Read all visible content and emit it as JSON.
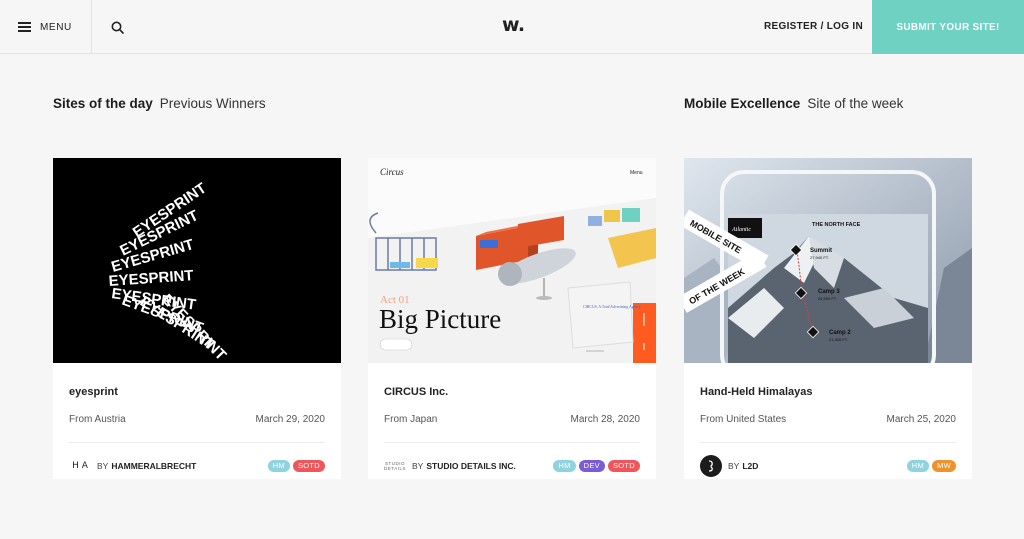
{
  "header": {
    "menu_label": "MENU",
    "logo": "w.",
    "auth_label": "REGISTER / LOG IN",
    "submit_label": "SUBMIT YOUR SITE!"
  },
  "sections": {
    "left": {
      "title": "Sites of the day",
      "subtitle": "Previous Winners"
    },
    "right": {
      "title": "Mobile Excellence",
      "subtitle": "Site of the week"
    }
  },
  "colors": {
    "accent": "#6ed1c1",
    "tag_hm": "#8fd3de",
    "tag_soto": "#f0555a",
    "tag_dev": "#7b5cd6",
    "tag_mw": "#f0922b"
  },
  "cards": [
    {
      "title": "eyesprint",
      "from": "From Austria",
      "date": "March 29, 2020",
      "by": "BY",
      "author": "HAMMERALBRECHT",
      "author_logo_text": "H A",
      "tags": [
        {
          "label": "HM",
          "color": "#8fd3de"
        },
        {
          "label": "SOTD",
          "color": "#f0555a"
        }
      ],
      "thumb_word": "EYESPRINT"
    },
    {
      "title": "CIRCUS Inc.",
      "from": "From Japan",
      "date": "March 28, 2020",
      "by": "BY",
      "author": "STUDIO DETAILS INC.",
      "author_logo_text": "STUDIO DETAILS",
      "tags": [
        {
          "label": "HM",
          "color": "#8fd3de"
        },
        {
          "label": "DEV",
          "color": "#7b5cd6"
        },
        {
          "label": "SOTD",
          "color": "#f0555a"
        }
      ],
      "thumb_brand": "Circus",
      "thumb_menu": "Menu",
      "thumb_act": "Act 01",
      "thumb_headline": "Big Picture",
      "thumb_note": "CIRCUS, A Total Advertising Agency"
    },
    {
      "title": "Hand-Held Himalayas",
      "from": "From United States",
      "date": "March 25, 2020",
      "by": "BY",
      "author": "L2D",
      "tags": [
        {
          "label": "HM",
          "color": "#8fd3de"
        },
        {
          "label": "MW",
          "color": "#f0922b"
        }
      ],
      "thumb_ribbon_1": "MOBILE SITE",
      "thumb_ribbon_2": "OF THE WEEK",
      "thumb_publisher": "Atlantic",
      "thumb_brand": "THE NORTH FACE",
      "thumb_points": [
        {
          "name": "Summit",
          "alt": "27,940 FT."
        },
        {
          "name": "Camp 3",
          "alt": "24,500 FT."
        },
        {
          "name": "Camp 2",
          "alt": "21,300 FT."
        }
      ]
    }
  ]
}
